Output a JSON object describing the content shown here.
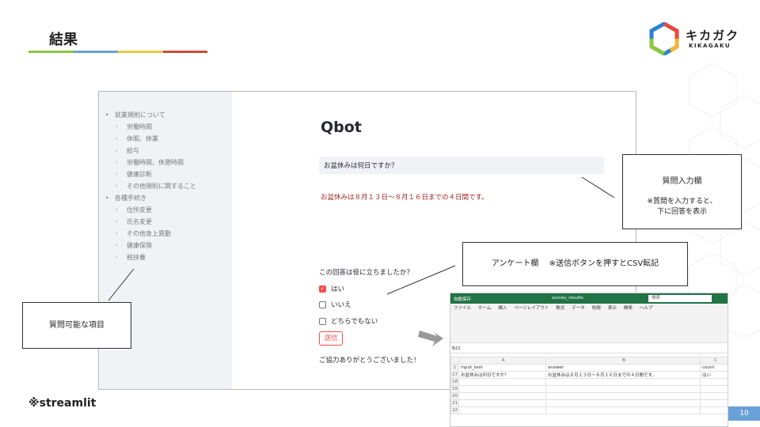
{
  "slide": {
    "title": "結果",
    "title_bar_colors": [
      "#8dc63f",
      "#6aa0d8",
      "#e8c84a",
      "#cc4b3a"
    ],
    "page_number": "10",
    "footnote": "※streamlit"
  },
  "brand": {
    "logo_text": "キカガク",
    "logo_sub": "KIKAGAKU"
  },
  "app": {
    "title": "Qbot",
    "sidebar_items": [
      {
        "label": "就業規則について",
        "level": 0
      },
      {
        "label": "労働時間",
        "level": 1
      },
      {
        "label": "休暇、休業",
        "level": 1
      },
      {
        "label": "給与",
        "level": 1
      },
      {
        "label": "労働時間、休憩時間",
        "level": 1
      },
      {
        "label": "健康診断",
        "level": 1
      },
      {
        "label": "その他規則に関すること",
        "level": 1
      },
      {
        "label": "各種手続き",
        "level": 0
      },
      {
        "label": "住所変更",
        "level": 1
      },
      {
        "label": "氏名変更",
        "level": 1
      },
      {
        "label": "その他身上異動",
        "level": 1
      },
      {
        "label": "健康保険",
        "level": 1
      },
      {
        "label": "税扶養",
        "level": 1
      }
    ],
    "question_value": "お盆休みは何日ですか？",
    "answer": "お盆休みは８月１３日～８月１６日までの４日間です。",
    "survey_question": "この回答は役に立ちましたか？",
    "options": [
      {
        "label": "はい",
        "checked": true
      },
      {
        "label": "いいえ",
        "checked": false
      },
      {
        "label": "どちらでもない",
        "checked": false
      }
    ],
    "submit_label": "送信",
    "thanks": "ご協力ありがとうございました！"
  },
  "callouts": {
    "input_title": "質問入力欄",
    "input_note_1": "※質問を入力すると、",
    "input_note_2": "下に回答を表示",
    "survey": "アンケート欄　 ※送信ボタンを押すとCSV転記",
    "sidebar": "質問可能な項目"
  },
  "excel": {
    "title_left": "自動保存",
    "filename": "survey_results",
    "search": "検索",
    "menu": [
      "ファイル",
      "ホーム",
      "挿入",
      "ページレイアウト",
      "数式",
      "データ",
      "校閲",
      "表示",
      "開発",
      "ヘルプ"
    ],
    "cell_ref": "B21",
    "columns": [
      "A",
      "B",
      "C"
    ],
    "rows": [
      {
        "num": "1",
        "cells": [
          "input_text",
          "answer",
          "count"
        ]
      },
      {
        "num": "17",
        "cells": [
          "お盆休みは何日ですか？",
          "お盆休みは８月１３日～８月１６日までの４日間です。",
          "はい"
        ]
      },
      {
        "num": "18",
        "cells": [
          "",
          "",
          ""
        ]
      },
      {
        "num": "19",
        "cells": [
          "",
          "",
          ""
        ]
      },
      {
        "num": "20",
        "cells": [
          "",
          "",
          ""
        ]
      },
      {
        "num": "21",
        "cells": [
          "",
          "",
          ""
        ]
      },
      {
        "num": "22",
        "cells": [
          "",
          "",
          ""
        ]
      }
    ]
  }
}
